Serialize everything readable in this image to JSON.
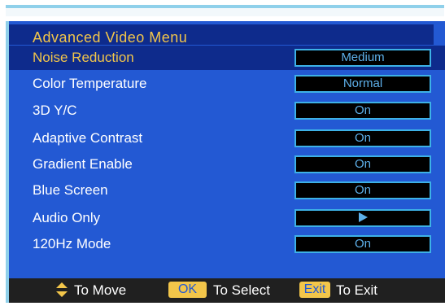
{
  "menu": {
    "title": "Advanced Video Menu",
    "items": [
      {
        "label": "Noise Reduction",
        "value": "Medium",
        "selected": true
      },
      {
        "label": "Color Temperature",
        "value": "Normal"
      },
      {
        "label": "3D Y/C",
        "value": "On"
      },
      {
        "label": "Adaptive Contrast",
        "value": "On"
      },
      {
        "label": "Gradient Enable",
        "value": "On"
      },
      {
        "label": "Blue Screen",
        "value": "On"
      },
      {
        "label": "Audio Only",
        "value": "",
        "icon": "play-arrow-icon"
      },
      {
        "label": "120Hz Mode",
        "value": "On"
      }
    ]
  },
  "footer": {
    "move_icon": "up-down-arrows-icon",
    "move_label": "To Move",
    "ok_key": "OK",
    "select_label": "To Select",
    "exit_key": "Exit",
    "exit_label": "To Exit"
  },
  "colors": {
    "background": "#2359d3",
    "header": "#0e2b8c",
    "highlight_text": "#f3c64a",
    "value_text": "#5eb0ea",
    "value_border": "#3db1e6",
    "footer": "#202020"
  }
}
